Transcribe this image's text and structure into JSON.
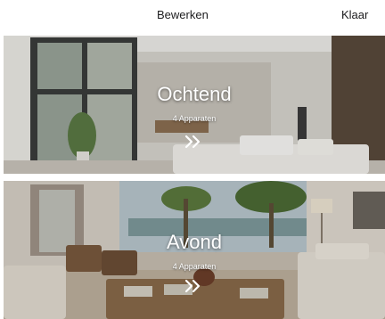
{
  "header": {
    "edit_label": "Bewerken",
    "done_label": "Klaar"
  },
  "scenes": [
    {
      "title": "Ochtend",
      "subtitle": "4 Apparaten",
      "icon": "double-chevron-right-icon"
    },
    {
      "title": "Avond",
      "subtitle": "4 Apparaten",
      "icon": "double-chevron-right-icon"
    }
  ]
}
